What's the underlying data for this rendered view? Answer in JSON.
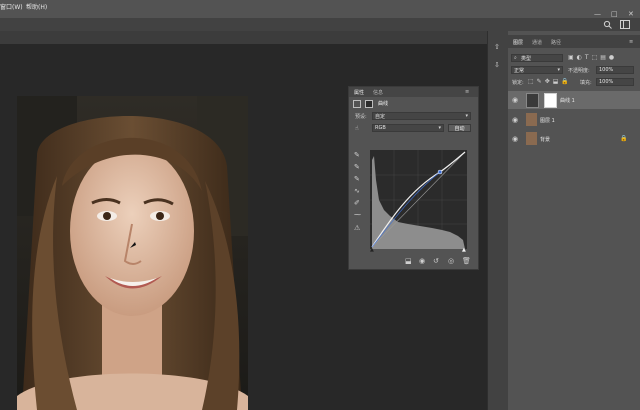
{
  "menubar": {
    "items": [
      "窗口(W)",
      "帮助(H)"
    ]
  },
  "properties": {
    "tabs": [
      "属性",
      "信息"
    ],
    "title": "曲线",
    "preset_label": "预设:",
    "preset_value": "自定",
    "channel_value": "RGB",
    "auto_button": "自动"
  },
  "layers": {
    "tabs": [
      "图层",
      "通道",
      "路径"
    ],
    "filter_value": "类型",
    "blend_mode": "正常",
    "opacity_label": "不透明度:",
    "opacity_value": "100%",
    "lock_label": "锁定:",
    "fill_label": "填充:",
    "fill_value": "100%",
    "items": [
      {
        "name": "曲线 1"
      },
      {
        "name": "图层 1"
      },
      {
        "name": "背景"
      }
    ]
  },
  "colors": {
    "ui_panel": "#535353",
    "ui_dark": "#282828",
    "curve_line": "#f0f0f0",
    "curve_point": "#3d6fd6"
  },
  "icons": [
    "search-icon",
    "workspace-icon",
    "eye-icon",
    "lock-icon",
    "eyedropper-icon",
    "trash-icon",
    "reset-icon",
    "mask-icon",
    "curves-icon"
  ]
}
